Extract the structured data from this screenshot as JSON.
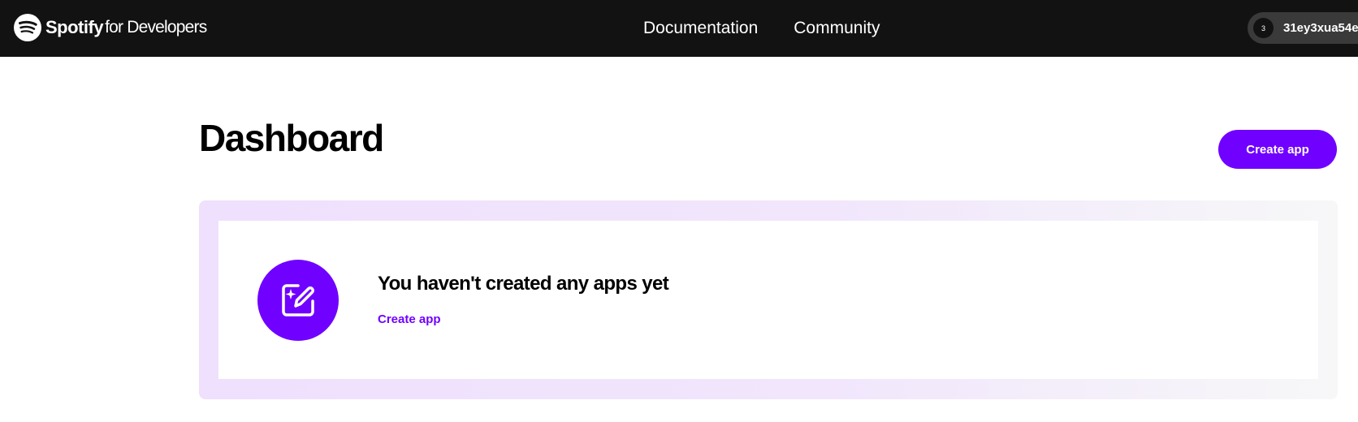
{
  "header": {
    "brand_name": "Spotify",
    "brand_suffix": "for Developers",
    "logo_icon": "spotify-logo-icon",
    "nav": [
      {
        "label": "Documentation"
      },
      {
        "label": "Community"
      }
    ],
    "user": {
      "avatar_text": "3",
      "username": "31ey3xua54e"
    }
  },
  "main": {
    "title": "Dashboard",
    "create_button_label": "Create app",
    "empty_state": {
      "icon": "edit-sparkle-icon",
      "heading": "You haven't created any apps yet",
      "link_label": "Create app"
    }
  },
  "colors": {
    "header_bg": "#121212",
    "accent": "#7000ff",
    "panel_gradient_start": "#efe0fd",
    "panel_gradient_end": "#f7f7f8"
  }
}
